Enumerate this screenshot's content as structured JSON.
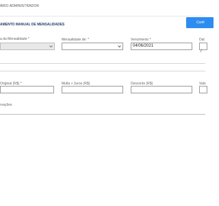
{
  "header": {
    "user_label": "ÁRIO ADMINISTRADOR",
    "confirm_label": "Confi"
  },
  "page": {
    "title": "AMENTO MANUAL DE MENSALIDADES"
  },
  "row1": {
    "tipo_label": "a da Mensalidade *",
    "tipo_value": "",
    "mensalidade_label": "Mensalidade de: *",
    "mensalidade_value": "",
    "vencimento_label": "Vencimento *",
    "vencimento_value": "04/06/2021",
    "data_label": "Dat"
  },
  "row2": {
    "original_label": "Original (R$) *",
    "original_value": "",
    "multa_label": "Multa + Juros (R$)",
    "multa_value": "",
    "desconto_label": "Desconto (R$)",
    "desconto_value": "",
    "valor_label": "Valo"
  },
  "row3": {
    "observacoes_label": "rvações"
  },
  "icons": {
    "chevron": "chevron-down-icon",
    "calendar": "calendar-icon"
  },
  "colors": {
    "accent": "#2d8cf0",
    "title": "#1f3f66",
    "disabled_bg": "#e8e8e8"
  }
}
